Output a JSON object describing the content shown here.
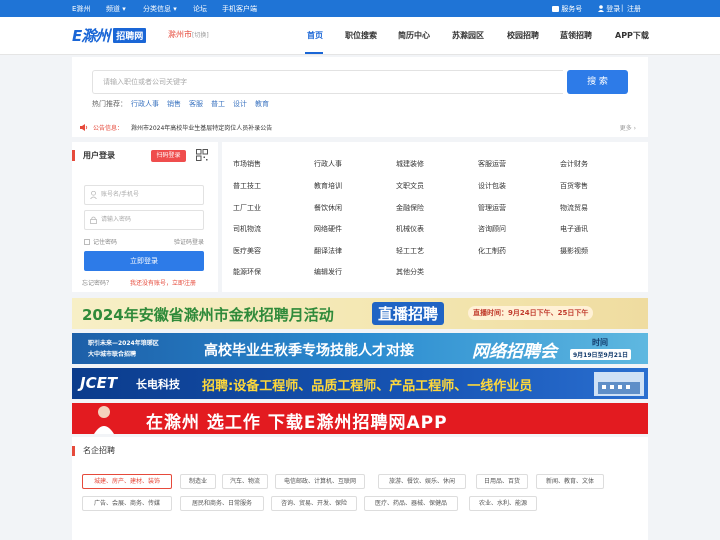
{
  "topbar": {
    "site": "E滁州",
    "channel": "频道",
    "classified": "分类信息",
    "forum": "论坛",
    "mobile_client": "手机客户端",
    "service": "服务号",
    "login": "登录",
    "register": "注册"
  },
  "header": {
    "logo_e": "E滁州",
    "logo_site": "招聘网",
    "city": "滁州市",
    "city_switch": "[切换]",
    "nav": [
      "首页",
      "职位搜索",
      "简历中心",
      "苏滁园区",
      "校园招聘",
      "蓝领招聘",
      "APP下载"
    ]
  },
  "search": {
    "placeholder": "请输入职位或者公司关键字",
    "button": "搜 索",
    "hot_label": "热门推荐：",
    "hot_words": [
      "行政人事",
      "销售",
      "客服",
      "普工",
      "设计",
      "教育"
    ]
  },
  "notice": {
    "label": "公告信息：",
    "text": "滁州市2024年高校毕业生基层特定岗位人员补录公告",
    "more": "更多 ›"
  },
  "login": {
    "title": "用户登录",
    "scan_button": "扫码登录",
    "username_placeholder": "账号名/手机号",
    "password_placeholder": "请输入密码",
    "remember": "记住密码",
    "code_login": "验证码登录",
    "submit": "立即登录",
    "forgot": "忘记密码？",
    "register": "我还没有账号，立即注册"
  },
  "categories": [
    "市场销售",
    "行政人事",
    "城建装修",
    "客服运营",
    "会计财务",
    "普工技工",
    "教育培训",
    "文职文员",
    "设计包装",
    "百货零售",
    "工厂工业",
    "餐饮休闲",
    "金融保险",
    "管理运营",
    "物流贸易",
    "司机物流",
    "网络硬件",
    "机械仪表",
    "咨询顾问",
    "电子通讯",
    "医疗美容",
    "翻译法律",
    "轻工工艺",
    "化工制药",
    "摄影视频",
    "能源环保",
    "编辑发行",
    "其他分类"
  ],
  "banners": {
    "b1": {
      "title": "2024年安徽省滁州市金秋招聘月活动",
      "tag": "直播招聘",
      "time": "直播时间：9月24日下午、25日下午"
    },
    "b2": {
      "sub1": "职引未来—2024年琅琊区",
      "sub2": "大中城市联合招聘",
      "title": "高校毕业生秋季专场技能人才对接",
      "tag": "网络招聘会",
      "time_label": "时间",
      "time": "9月19日至9月21日"
    },
    "b3": {
      "brand": "JCET",
      "brand_zh": "长电科技",
      "title": "招聘:设备工程师、品质工程师、产品工程师、一线作业员"
    },
    "b4": {
      "text": "在滁州  选工作  下载E滁州招聘网APP"
    }
  },
  "famous": {
    "title": "名企招聘",
    "tags": [
      "城建、房产、建材、装饰",
      "制造业",
      "汽车、物流",
      "电信邮政、计算机、互联网",
      "旅游、餐饮、娱乐、休闲",
      "日用品、百货",
      "新闻、教育、文体",
      "广告、会展、商务、传媒",
      "居民和商务、日常服务",
      "咨询、贸易、开发、保险",
      "医疗、药品、器械、保健品",
      "农业、水利、能源"
    ]
  },
  "colors": {
    "brand": "#1f74d6",
    "accent": "#e64a3b",
    "button": "#2d7be8"
  }
}
